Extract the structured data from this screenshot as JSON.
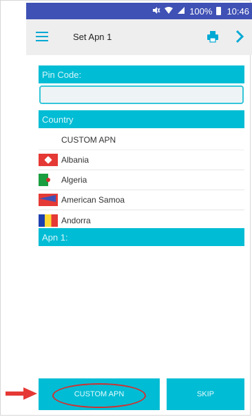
{
  "status_bar": {
    "battery": "100%",
    "time": "10:46"
  },
  "toolbar": {
    "title": "Set Apn 1"
  },
  "form": {
    "pin_label": "Pin Code:",
    "pin_value": "",
    "country_label": "Country",
    "apn_label": "Apn 1:"
  },
  "countries": [
    {
      "name": "CUSTOM APN",
      "flag": ""
    },
    {
      "name": "Albania",
      "flag": "albania-flag"
    },
    {
      "name": "Algeria",
      "flag": "algeria-flag"
    },
    {
      "name": "American Samoa",
      "flag": "samoa-flag"
    },
    {
      "name": "Andorra",
      "flag": "andorra-flag"
    }
  ],
  "buttons": {
    "custom_apn": "CUSTOM APN",
    "skip": "SKIP"
  },
  "colors": {
    "accent": "#00bcd4",
    "status_bar": "#3f51b5",
    "annotation": "#d32f2f"
  }
}
